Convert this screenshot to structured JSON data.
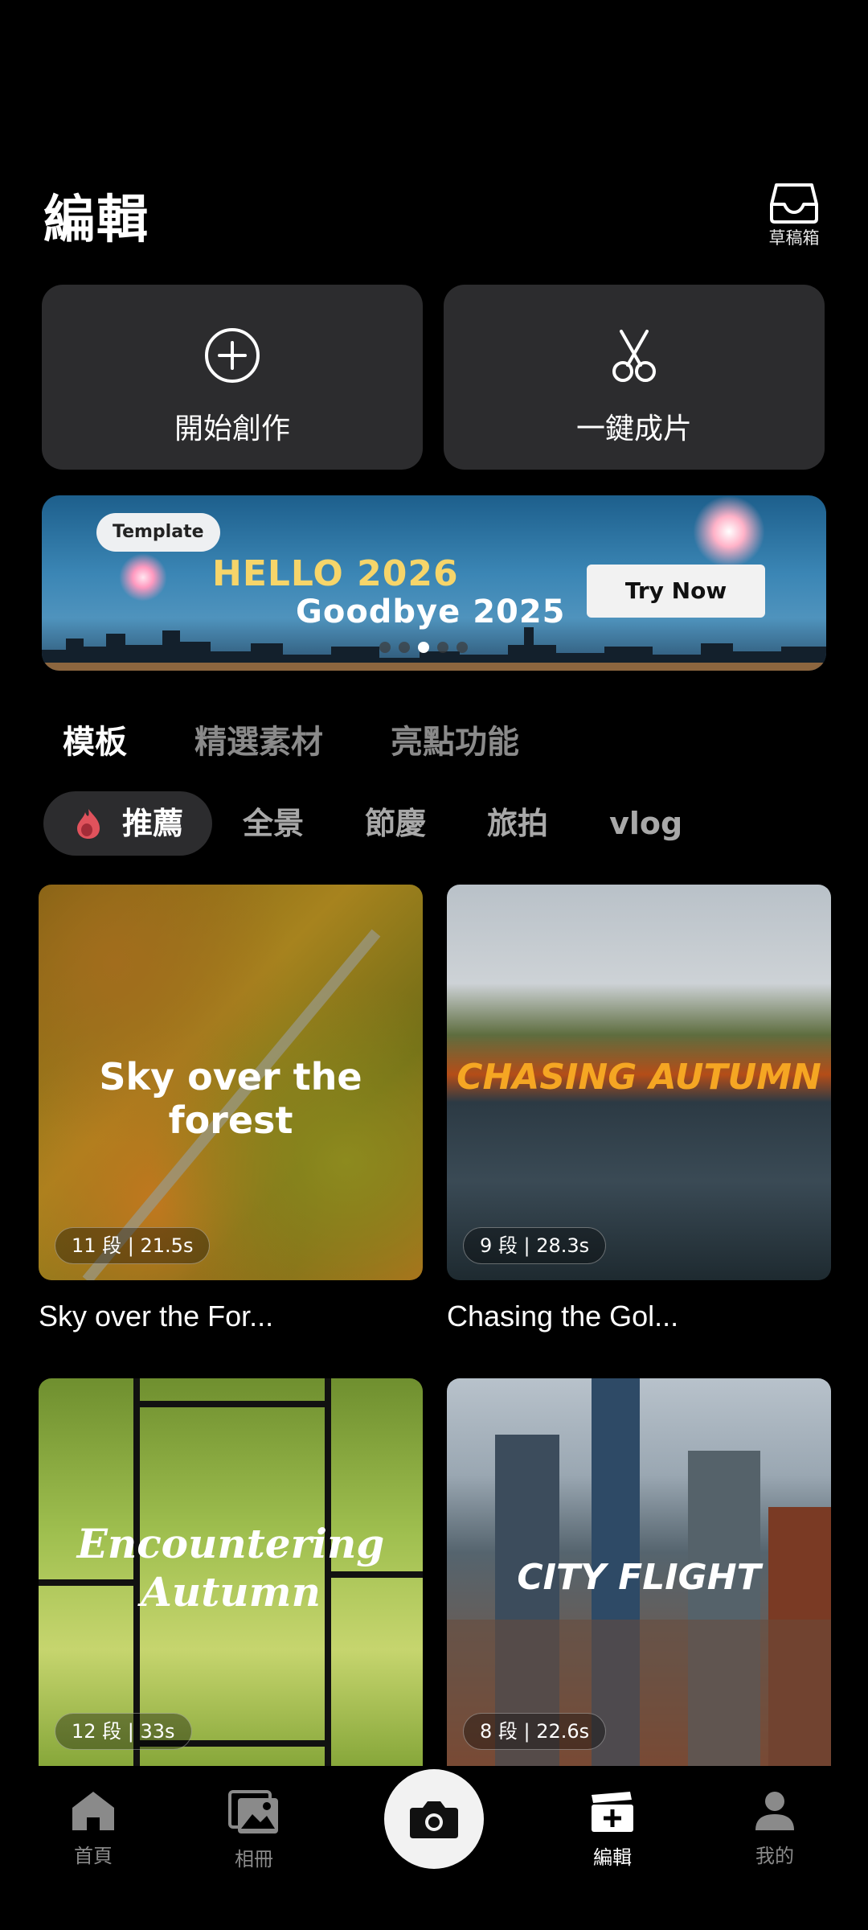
{
  "header": {
    "title": "編輯",
    "drafts_label": "草稿箱"
  },
  "actions": [
    {
      "label": "開始創作",
      "icon": "plus-circle-icon"
    },
    {
      "label": "一鍵成片",
      "icon": "scissors-icon"
    }
  ],
  "banner": {
    "tag": "Template",
    "line1": "HELLO 2026",
    "line2": "Goodbye 2025",
    "cta": "Try Now",
    "page_count": 5,
    "active_page": 3
  },
  "tabs": [
    "模板",
    "精選素材",
    "亮點功能"
  ],
  "active_tab": 0,
  "chips": [
    "推薦",
    "全景",
    "節慶",
    "旅拍",
    "vlog"
  ],
  "active_chip": 0,
  "templates": [
    {
      "overlay": "Sky over the forest",
      "meta": "11 段 | 21.5s",
      "title": "Sky over the For..."
    },
    {
      "overlay": "CHASING AUTUMN",
      "meta": "9 段 | 28.3s",
      "title": "Chasing the Gol..."
    },
    {
      "overlay": "Encountering Autumn",
      "meta": "12 段 | 33s",
      "title": ""
    },
    {
      "overlay": "CITY FLIGHT",
      "meta": "8 段 | 22.6s",
      "title": ""
    }
  ],
  "bottom_nav": [
    {
      "label": "首頁",
      "icon": "home-icon"
    },
    {
      "label": "相冊",
      "icon": "album-icon"
    },
    {
      "label": "",
      "icon": "camera-icon"
    },
    {
      "label": "編輯",
      "icon": "edit-clapper-icon"
    },
    {
      "label": "我的",
      "icon": "profile-icon"
    }
  ],
  "active_nav": 3,
  "colors": {
    "card_bg": "#2c2c2e",
    "inactive_text": "#8a8a8a",
    "banner_gold": "#f6d56a"
  }
}
